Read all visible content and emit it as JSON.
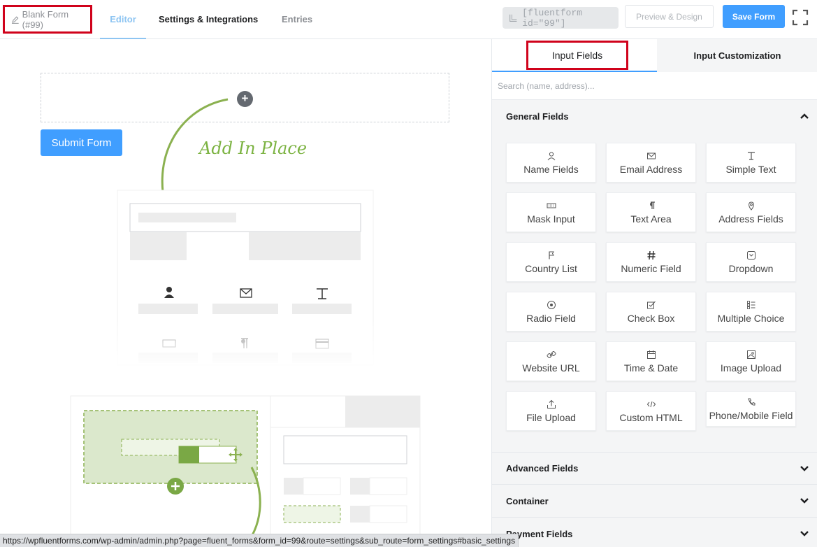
{
  "topbar": {
    "form_title": "Blank Form (#99)",
    "tabs": [
      {
        "label": "Editor"
      },
      {
        "label": "Settings & Integrations"
      },
      {
        "label": "Entries"
      }
    ],
    "shortcode": "[fluentform id=\"99\"]",
    "preview_label": "Preview & Design",
    "save_label": "Save Form"
  },
  "canvas": {
    "submit_label": "Submit Form",
    "hint_text": "Add In Place",
    "plus_symbol": "+"
  },
  "panel": {
    "tabs": [
      {
        "label": "Input Fields"
      },
      {
        "label": "Input Customization"
      }
    ],
    "search_placeholder": "Search (name, address)...",
    "general_title": "General Fields",
    "fields": [
      {
        "label": "Name Fields",
        "icon": "user-icon"
      },
      {
        "label": "Email Address",
        "icon": "envelope-icon"
      },
      {
        "label": "Simple Text",
        "icon": "text-icon"
      },
      {
        "label": "Mask Input",
        "icon": "keyboard-icon"
      },
      {
        "label": "Text Area",
        "icon": "paragraph-icon"
      },
      {
        "label": "Address Fields",
        "icon": "map-pin-icon"
      },
      {
        "label": "Country List",
        "icon": "flag-icon"
      },
      {
        "label": "Numeric Field",
        "icon": "hash-icon"
      },
      {
        "label": "Dropdown",
        "icon": "dropdown-icon"
      },
      {
        "label": "Radio Field",
        "icon": "radio-icon"
      },
      {
        "label": "Check Box",
        "icon": "checkbox-icon"
      },
      {
        "label": "Multiple Choice",
        "icon": "list-icon"
      },
      {
        "label": "Website URL",
        "icon": "link-icon"
      },
      {
        "label": "Time & Date",
        "icon": "calendar-icon"
      },
      {
        "label": "Image Upload",
        "icon": "image-icon"
      },
      {
        "label": "File Upload",
        "icon": "upload-icon"
      },
      {
        "label": "Custom HTML",
        "icon": "code-icon"
      },
      {
        "label": "Phone/Mobile Field",
        "icon": "phone-icon"
      }
    ],
    "sections": [
      {
        "label": "Advanced Fields"
      },
      {
        "label": "Container"
      },
      {
        "label": "Payment Fields"
      }
    ]
  },
  "statusbar": {
    "url": "https://wpfluentforms.com/wp-admin/admin.php?page=fluent_forms&form_id=99&route=settings&sub_route=form_settings#basic_settings"
  },
  "colors": {
    "primary": "#409eff",
    "highlight_red": "#d0021b",
    "hint_green": "#7cb342"
  }
}
